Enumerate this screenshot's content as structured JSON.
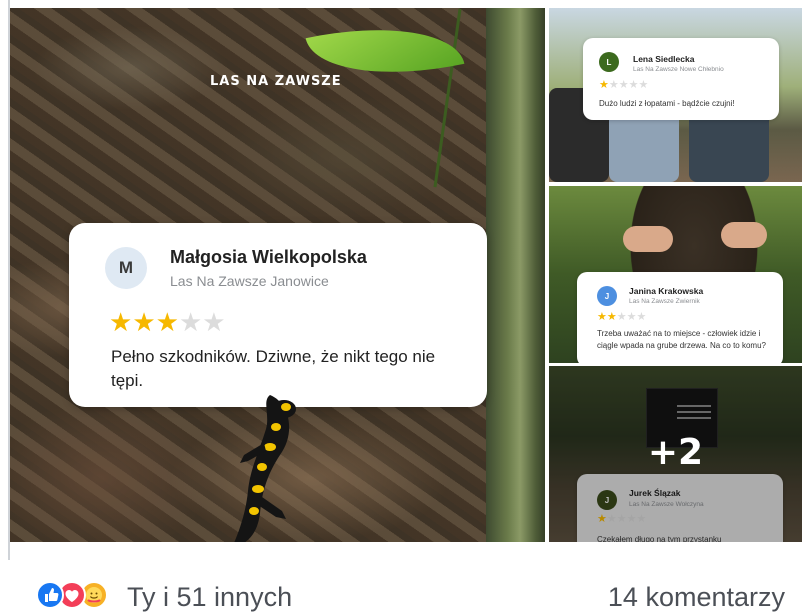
{
  "brand": {
    "name": "LAS NA ZAWSZE"
  },
  "main_review": {
    "avatar_initial": "M",
    "name": "Małgosia Wielkopolska",
    "place": "Las Na Zawsze Janowice",
    "rating": 3,
    "max_rating": 5,
    "text": "Pełno szkodników. Dziwne, że nikt tego nie tępi."
  },
  "side_reviews": [
    {
      "avatar_initial": "L",
      "name": "Lena Siedlecka",
      "place": "Las Na Zawsze Nowe Chłebnio",
      "rating": 1,
      "max_rating": 5,
      "text": "Dużo ludzi z łopatami - bądźcie czujni!"
    },
    {
      "avatar_initial": "J",
      "name": "Janina Krakowska",
      "place": "Las Na Zawsze Zwiernik",
      "rating": 2,
      "max_rating": 5,
      "text": "Trzeba uważać na to miejsce - człowiek idzie i ciągle wpada na grube drzewa. Na co to komu?"
    },
    {
      "avatar_initial": "J",
      "name": "Jurek Ślązak",
      "place": "Las Na Zawsze Wołczyna",
      "rating": 1,
      "max_rating": 5,
      "text": "Czekałem długo na tym przystanku"
    }
  ],
  "more_photos": "+2",
  "reactions": {
    "icons": [
      "like-icon",
      "love-icon",
      "care-icon"
    ],
    "text": "Ty i 51 innych"
  },
  "comments": {
    "text": "14 komentarzy"
  },
  "colors": {
    "star_active": "#f6b800",
    "star_inactive": "#dcdcdc",
    "like": "#1877f2",
    "love": "#f33e58",
    "care": "#f7b125"
  }
}
